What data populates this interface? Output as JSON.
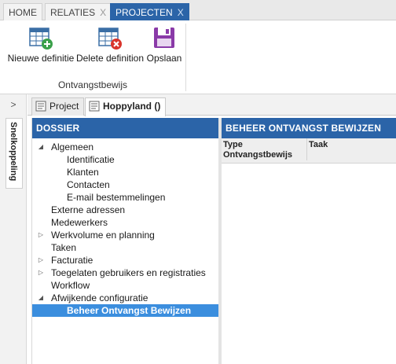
{
  "top_tabs": [
    {
      "label": "HOME",
      "closable": false
    },
    {
      "label": "RELATIES",
      "closable": true,
      "close": "X"
    },
    {
      "label": "PROJECTEN",
      "closable": true,
      "close": "X",
      "active": true
    }
  ],
  "ribbon": {
    "buttons": [
      {
        "label": "Nieuwe definitie",
        "icon": "table-add-icon"
      },
      {
        "label": "Delete definition",
        "icon": "table-delete-icon"
      },
      {
        "label": "Opslaan",
        "icon": "save-icon"
      }
    ],
    "group_label": "Ontvangstbewijs"
  },
  "sidebar": {
    "expander": ">",
    "snelkoppeling": "Snelkoppeling"
  },
  "doc_tabs": [
    {
      "label": "Project",
      "icon": "document-icon"
    },
    {
      "label": "Hoppyland ()",
      "icon": "document-icon",
      "active": true
    }
  ],
  "dossier": {
    "title": "DOSSIER",
    "items": [
      {
        "label": "Algemeen",
        "toggle": "◢"
      },
      {
        "label": "Identificatie"
      },
      {
        "label": "Klanten"
      },
      {
        "label": "Contacten"
      },
      {
        "label": "E-mail bestemmelingen"
      },
      {
        "label": "Externe adressen"
      },
      {
        "label": "Medewerkers"
      },
      {
        "label": "Werkvolume en planning",
        "toggle": "▷"
      },
      {
        "label": "Taken"
      },
      {
        "label": "Facturatie",
        "toggle": "▷"
      },
      {
        "label": "Toegelaten gebruikers en registraties",
        "toggle": "▷"
      },
      {
        "label": "Workflow"
      },
      {
        "label": "Afwijkende configuratie",
        "toggle": "◢"
      },
      {
        "label": "Beheer Ontvangst Bewijzen",
        "selected": true
      }
    ]
  },
  "beheer": {
    "title": "BEHEER ONTVANGST BEWIJZEN",
    "columns": [
      "Type Ontvangstbewijs",
      "Taak"
    ]
  },
  "colors": {
    "accent": "#2b64a8",
    "selection": "#3b8ede"
  }
}
